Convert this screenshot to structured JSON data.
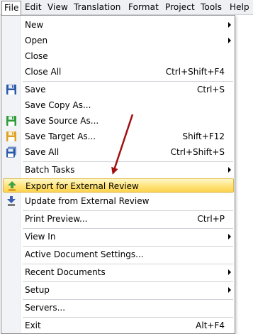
{
  "menubar": {
    "items": [
      "File",
      "Edit",
      "View",
      "Translation",
      "Format",
      "Project",
      "Tools",
      "Help"
    ],
    "active": "File"
  },
  "menu": {
    "items": [
      {
        "label": "New",
        "submenu": true
      },
      {
        "label": "Open",
        "submenu": true
      },
      {
        "label": "Close"
      },
      {
        "label": "Close All",
        "shortcut": "Ctrl+Shift+F4"
      },
      {
        "label": "Save",
        "shortcut": "Ctrl+S",
        "icon": "save-icon"
      },
      {
        "label": "Save Copy As..."
      },
      {
        "label": "Save Source As...",
        "icon": "save-source-icon"
      },
      {
        "label": "Save Target As...",
        "shortcut": "Shift+F12",
        "icon": "save-target-icon"
      },
      {
        "label": "Save All",
        "shortcut": "Ctrl+Shift+S",
        "icon": "save-all-icon"
      },
      {
        "label": "Batch Tasks",
        "submenu": true
      },
      {
        "label": "Export for External Review",
        "icon": "export-review-icon",
        "highlighted": true
      },
      {
        "label": "Update from External Review",
        "icon": "update-review-icon"
      },
      {
        "label": "Print Preview...",
        "shortcut": "Ctrl+P"
      },
      {
        "label": "View In",
        "submenu": true
      },
      {
        "label": "Active Document Settings..."
      },
      {
        "label": "Recent Documents",
        "submenu": true
      },
      {
        "label": "Setup",
        "submenu": true
      },
      {
        "label": "Servers..."
      },
      {
        "label": "Exit",
        "shortcut": "Alt+F4"
      }
    ]
  },
  "colors": {
    "highlight": "#ffe37a",
    "annotation_arrow": "#a01010"
  }
}
